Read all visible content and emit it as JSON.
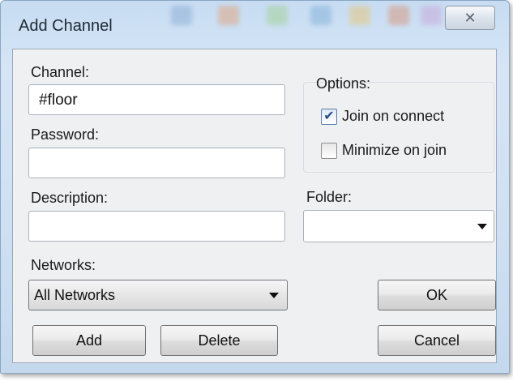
{
  "window": {
    "title": "Add Channel",
    "close_glyph": "✕"
  },
  "channel": {
    "label": "Channel:",
    "value": "#floor"
  },
  "password": {
    "label": "Password:",
    "value": ""
  },
  "description": {
    "label": "Description:",
    "value": ""
  },
  "options": {
    "label": "Options:",
    "join_on_connect": {
      "label": "Join on connect",
      "checked": true,
      "glyph": "✔"
    },
    "minimize_on_join": {
      "label": "Minimize on join",
      "checked": false
    }
  },
  "folder": {
    "label": "Folder:",
    "selected": ""
  },
  "networks": {
    "label": "Networks:",
    "selected": "All Networks"
  },
  "buttons": {
    "add": "Add",
    "delete": "Delete",
    "ok": "OK",
    "cancel": "Cancel"
  },
  "icons": [
    "close-icon",
    "check-icon",
    "chevron-down-icon"
  ]
}
